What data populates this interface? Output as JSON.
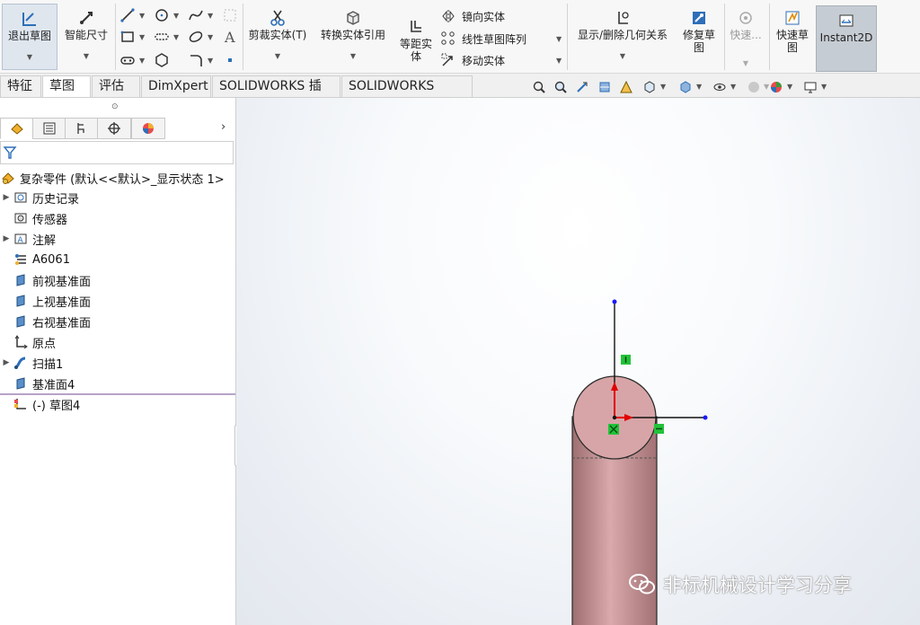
{
  "ribbon": {
    "exit_sketch": "退出草图",
    "smart_dimension": "智能尺寸",
    "trim_entities": "剪裁实体(T)",
    "convert_entities": "转换实体引用",
    "offset_entities_line1": "等距实",
    "offset_entities_line2": "体",
    "mirror_entities": "镜向实体",
    "linear_pattern": "线性草图阵列",
    "move_entities": "移动实体",
    "display_relations": "显示/删除几何关系",
    "repair_sketch_line1": "修复草",
    "repair_sketch_line2": "图",
    "quick_snaps": "快速...",
    "rapid_sketch_line1": "快速草",
    "rapid_sketch_line2": "图",
    "instant2d": "Instant2D"
  },
  "tabs": [
    {
      "label": "特征"
    },
    {
      "label": "草图"
    },
    {
      "label": "评估"
    },
    {
      "label": "DimXpert"
    },
    {
      "label": "SOLIDWORKS 插件"
    },
    {
      "label": "SOLIDWORKS MBD"
    }
  ],
  "tree": {
    "root": "复杂零件  (默认<<默认>_显示状态 1>",
    "items": [
      {
        "label": "历史记录"
      },
      {
        "label": "传感器"
      },
      {
        "label": "注解"
      },
      {
        "label": "A6061"
      },
      {
        "label": "前视基准面"
      },
      {
        "label": "上视基准面"
      },
      {
        "label": "右视基准面"
      },
      {
        "label": "原点"
      },
      {
        "label": "扫描1"
      },
      {
        "label": "基准面4"
      },
      {
        "label": "(-) 草图4"
      }
    ]
  },
  "watermark": "非标机械设计学习分享",
  "colors": {
    "part_fill": "#d7a5a7",
    "part_edge": "#2a2a2a",
    "axis_red": "#e00000",
    "relation_green": "#22c23a",
    "point_blue": "#1a1aff"
  }
}
